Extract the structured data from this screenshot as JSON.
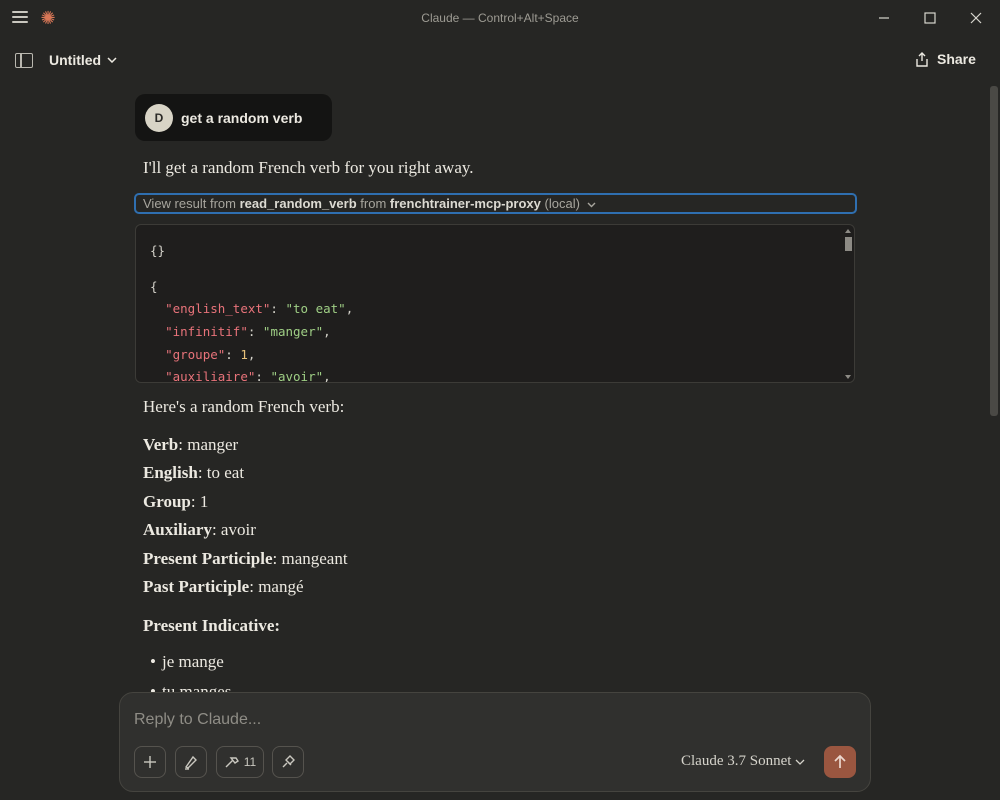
{
  "window": {
    "title": "Claude — Control+Alt+Space"
  },
  "header": {
    "doc_title": "Untitled",
    "share_label": "Share"
  },
  "user_message": {
    "avatar_initial": "D",
    "text": "get a random verb"
  },
  "assistant": {
    "intro": "I'll get a random French verb for you right away.",
    "tool_call": {
      "prefix": "View result from",
      "tool_name": "read_random_verb",
      "from_word": "from",
      "server": "frenchtrainer-mcp-proxy",
      "scope": "(local)"
    },
    "code": {
      "line1": "{}",
      "line2": "{",
      "fields": [
        {
          "key": "\"english_text\"",
          "value": "\"to eat\"",
          "trail": ","
        },
        {
          "key": "\"infinitif\"",
          "value": "\"manger\"",
          "trail": ","
        },
        {
          "key": "\"groupe\"",
          "value": "1",
          "trail": ","
        },
        {
          "key": "\"auxiliaire\"",
          "value": "\"avoir\"",
          "trail": ","
        }
      ]
    },
    "summary_intro": "Here's a random French verb:",
    "details": [
      {
        "label": "Verb",
        "value": ": manger"
      },
      {
        "label": "English",
        "value": ": to eat"
      },
      {
        "label": "Group",
        "value": ": 1"
      },
      {
        "label": "Auxiliary",
        "value": ": avoir"
      },
      {
        "label": "Present Participle",
        "value": ": mangeant"
      },
      {
        "label": "Past Participle",
        "value": ": mangé"
      }
    ],
    "section_title": "Present Indicative:",
    "conjugations": [
      "je mange",
      "tu manges"
    ]
  },
  "composer": {
    "placeholder": "Reply to Claude...",
    "tools_count": "11",
    "model": "Claude 3.7 Sonnet"
  }
}
